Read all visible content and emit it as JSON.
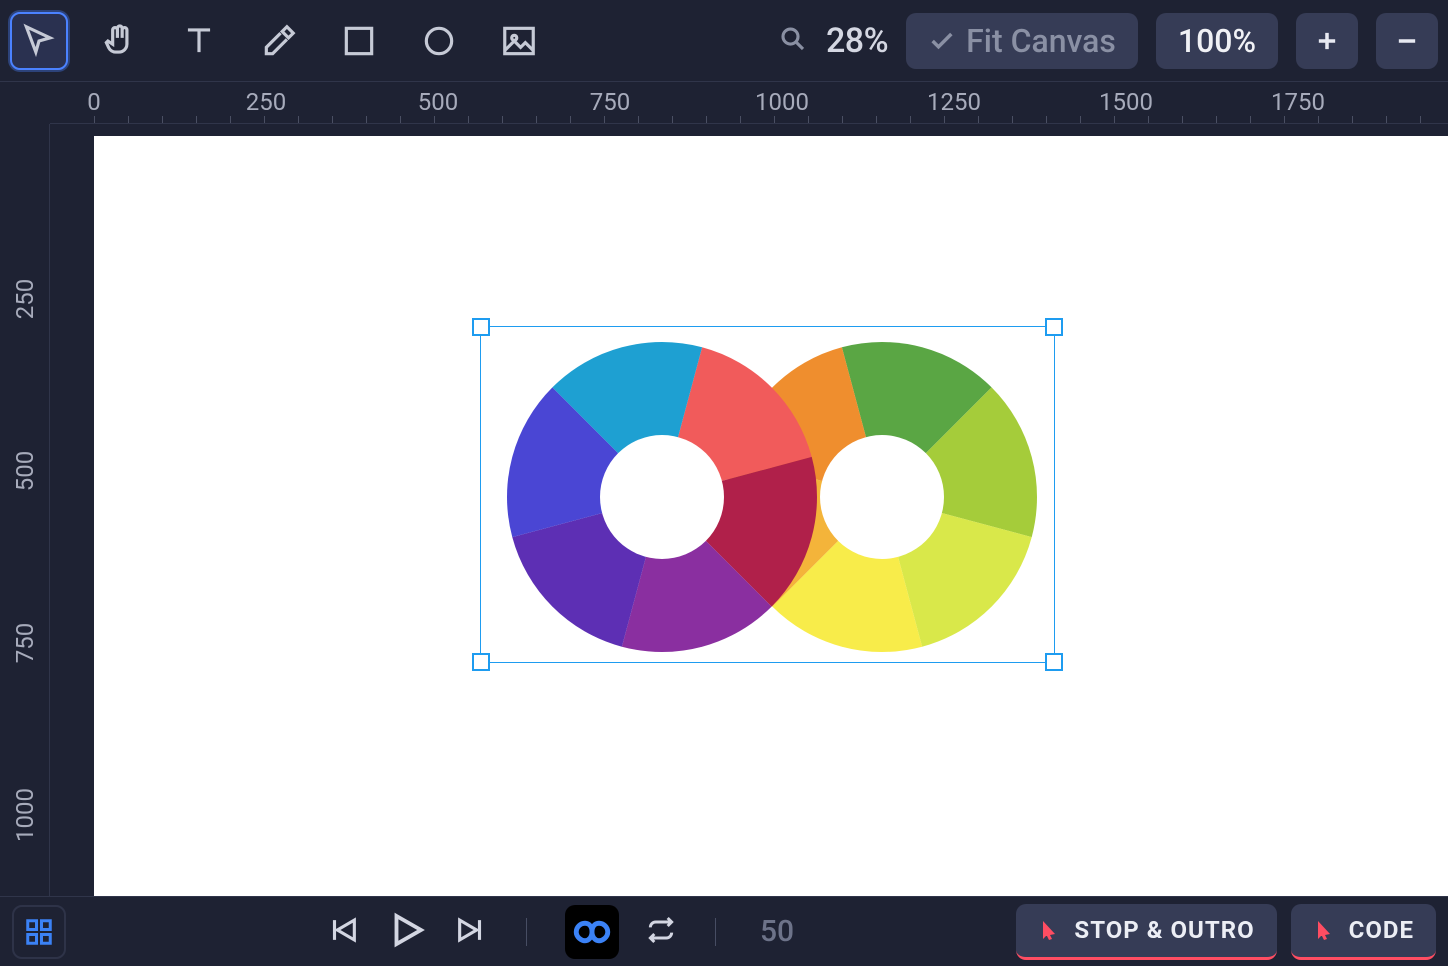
{
  "toolbar": {
    "tools": [
      "select",
      "hand",
      "text",
      "eyedropper",
      "rectangle",
      "ellipse",
      "image"
    ],
    "zoom_pct": "28%",
    "fit_canvas_label": "Fit Canvas",
    "hundred_label": "100%"
  },
  "ruler": {
    "h_ticks": [
      "0",
      "250",
      "500",
      "750",
      "1000",
      "1250",
      "1500",
      "1750"
    ],
    "v_ticks": [
      "250",
      "500",
      "750",
      "1000"
    ]
  },
  "selection": {
    "left_donut_colors": [
      "#f15b5b",
      "#b0204a",
      "#8a2fa0",
      "#5d2fb4",
      "#4a46d4",
      "#1ea0d2"
    ],
    "right_donut_colors": [
      "#5aa644",
      "#a5cc3a",
      "#d9e84a",
      "#f8ec4a",
      "#f4b43a",
      "#ef8e2e"
    ]
  },
  "timeline": {
    "frame": "50",
    "stop_label": "STOP & OUTRO",
    "code_label": "CODE"
  }
}
